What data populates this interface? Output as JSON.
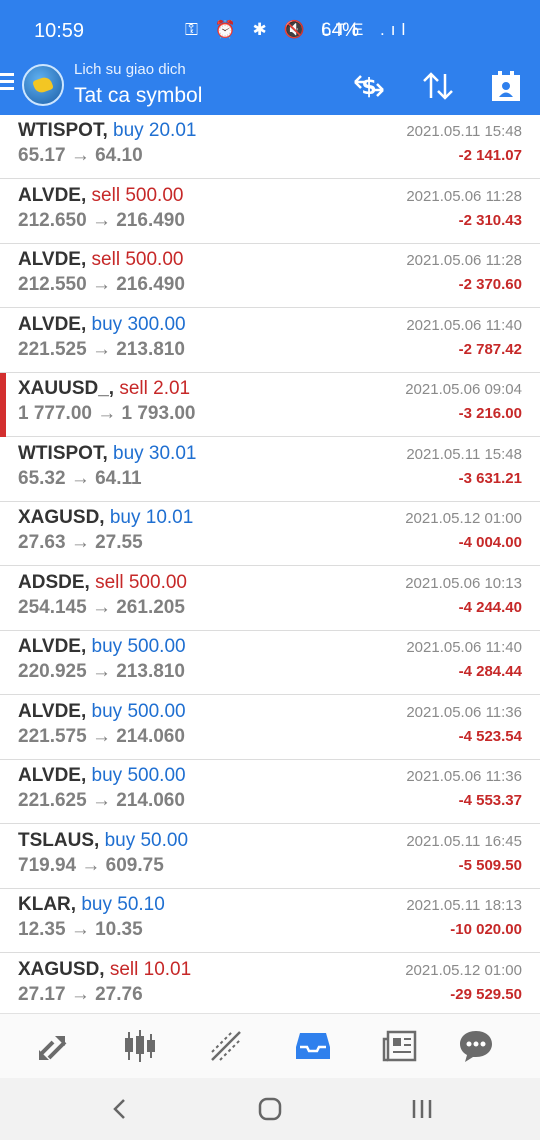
{
  "status_bar": {
    "time": "10:59",
    "icons": "⚿ ⏰ ✱ 🔇 LTE .ıl",
    "battery": "64%"
  },
  "header": {
    "subtitle": "Lich su giao dich",
    "title": "Tat ca symbol",
    "accent": "#2f80ed"
  },
  "trades": [
    {
      "symbol": "WTISPOT,",
      "side": "buy 20.01",
      "prices": "65.17 → 64.10",
      "time": "2021.05.11 15:48",
      "profit": "-2 141.07"
    },
    {
      "symbol": "ALVDE,",
      "side": "sell 500.00",
      "prices": "212.650 → 216.490",
      "time": "2021.05.06 11:28",
      "profit": "-2 310.43"
    },
    {
      "symbol": "ALVDE,",
      "side": "sell 500.00",
      "prices": "212.550 → 216.490",
      "time": "2021.05.06 11:28",
      "profit": "-2 370.60"
    },
    {
      "symbol": "ALVDE,",
      "side": "buy 300.00",
      "prices": "221.525 → 213.810",
      "time": "2021.05.06 11:40",
      "profit": "-2 787.42"
    },
    {
      "symbol": "XAUUSD_,",
      "side": "sell 2.01",
      "prices": "1 777.00 → 1 793.00",
      "time": "2021.05.06 09:04",
      "profit": "-3 216.00"
    },
    {
      "symbol": "WTISPOT,",
      "side": "buy 30.01",
      "prices": "65.32 → 64.11",
      "time": "2021.05.11 15:48",
      "profit": "-3 631.21"
    },
    {
      "symbol": "XAGUSD,",
      "side": "buy 10.01",
      "prices": "27.63 → 27.55",
      "time": "2021.05.12 01:00",
      "profit": "-4 004.00"
    },
    {
      "symbol": "ADSDE,",
      "side": "sell 500.00",
      "prices": "254.145 → 261.205",
      "time": "2021.05.06 10:13",
      "profit": "-4 244.40"
    },
    {
      "symbol": "ALVDE,",
      "side": "buy 500.00",
      "prices": "220.925 → 213.810",
      "time": "2021.05.06 11:40",
      "profit": "-4 284.44"
    },
    {
      "symbol": "ALVDE,",
      "side": "buy 500.00",
      "prices": "221.575 → 214.060",
      "time": "2021.05.06 11:36",
      "profit": "-4 523.54"
    },
    {
      "symbol": "ALVDE,",
      "side": "buy 500.00",
      "prices": "221.625 → 214.060",
      "time": "2021.05.06 11:36",
      "profit": "-4 553.37"
    },
    {
      "symbol": "TSLAUS,",
      "side": "buy 50.00",
      "prices": "719.94 → 609.75",
      "time": "2021.05.11 16:45",
      "profit": "-5 509.50"
    },
    {
      "symbol": "KLAR,",
      "side": "buy 50.10",
      "prices": "12.35 → 10.35",
      "time": "2021.05.11 18:13",
      "profit": "-10 020.00"
    },
    {
      "symbol": "XAGUSD,",
      "side": "sell 10.01",
      "prices": "27.17 → 27.76",
      "time": "2021.05.12 01:00",
      "profit": "-29 529.50"
    }
  ],
  "colors": {
    "buy": "#1f6fd1",
    "sell": "#c62828",
    "loss": "#c62828",
    "nav_active": "#2f80ed"
  }
}
